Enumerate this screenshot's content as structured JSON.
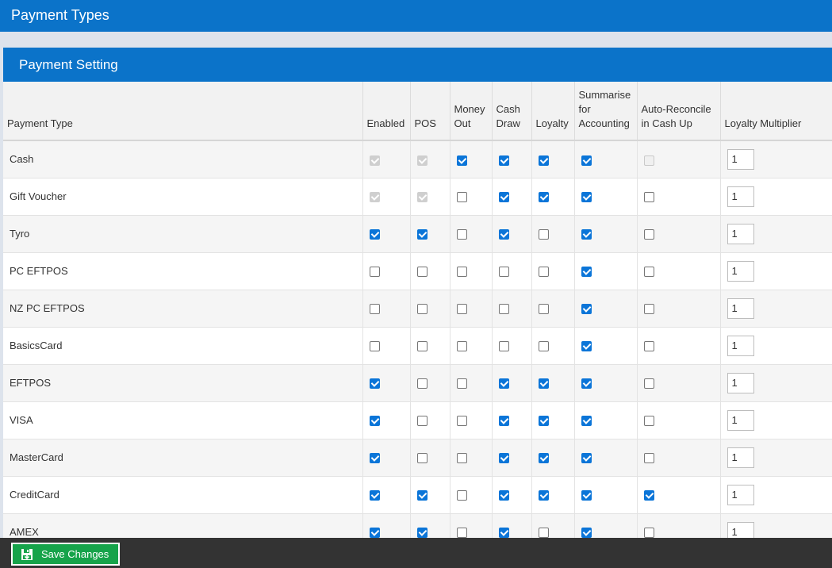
{
  "header": {
    "title": "Payment Types"
  },
  "panel": {
    "title": "Payment Setting"
  },
  "table": {
    "columns": {
      "payment_type": "Payment Type",
      "enabled": "Enabled",
      "pos": "POS",
      "money_out_1": "Money",
      "money_out_2": "Out",
      "cash_draw_1": "Cash",
      "cash_draw_2": "Draw",
      "loyalty": "Loyalty",
      "summarise_1": "Summarise",
      "summarise_2": "for",
      "summarise_3": "Accounting",
      "auto_1": "Auto-Reconcile",
      "auto_2": "in Cash Up",
      "loyalty_multiplier": "Loyalty Multiplier"
    },
    "rows": [
      {
        "name": "Cash",
        "enabled": true,
        "enabled_disabled": true,
        "pos": true,
        "pos_disabled": true,
        "money_out": true,
        "cash_draw": true,
        "loyalty": true,
        "summarise": true,
        "auto_reconcile": false,
        "auto_disabled": true,
        "multiplier": "1"
      },
      {
        "name": "Gift Voucher",
        "enabled": true,
        "enabled_disabled": true,
        "pos": true,
        "pos_disabled": true,
        "money_out": false,
        "cash_draw": true,
        "loyalty": true,
        "summarise": true,
        "auto_reconcile": false,
        "auto_disabled": false,
        "multiplier": "1"
      },
      {
        "name": "Tyro",
        "enabled": true,
        "enabled_disabled": false,
        "pos": true,
        "pos_disabled": false,
        "money_out": false,
        "cash_draw": true,
        "loyalty": false,
        "summarise": true,
        "auto_reconcile": false,
        "auto_disabled": false,
        "multiplier": "1"
      },
      {
        "name": "PC EFTPOS",
        "enabled": false,
        "enabled_disabled": false,
        "pos": false,
        "pos_disabled": false,
        "money_out": false,
        "cash_draw": false,
        "loyalty": false,
        "summarise": true,
        "auto_reconcile": false,
        "auto_disabled": false,
        "multiplier": "1"
      },
      {
        "name": "NZ PC EFTPOS",
        "enabled": false,
        "enabled_disabled": false,
        "pos": false,
        "pos_disabled": false,
        "money_out": false,
        "cash_draw": false,
        "loyalty": false,
        "summarise": true,
        "auto_reconcile": false,
        "auto_disabled": false,
        "multiplier": "1"
      },
      {
        "name": "BasicsCard",
        "enabled": false,
        "enabled_disabled": false,
        "pos": false,
        "pos_disabled": false,
        "money_out": false,
        "cash_draw": false,
        "loyalty": false,
        "summarise": true,
        "auto_reconcile": false,
        "auto_disabled": false,
        "multiplier": "1"
      },
      {
        "name": "EFTPOS",
        "enabled": true,
        "enabled_disabled": false,
        "pos": false,
        "pos_disabled": false,
        "money_out": false,
        "cash_draw": true,
        "loyalty": true,
        "summarise": true,
        "auto_reconcile": false,
        "auto_disabled": false,
        "multiplier": "1"
      },
      {
        "name": "VISA",
        "enabled": true,
        "enabled_disabled": false,
        "pos": false,
        "pos_disabled": false,
        "money_out": false,
        "cash_draw": true,
        "loyalty": true,
        "summarise": true,
        "auto_reconcile": false,
        "auto_disabled": false,
        "multiplier": "1"
      },
      {
        "name": "MasterCard",
        "enabled": true,
        "enabled_disabled": false,
        "pos": false,
        "pos_disabled": false,
        "money_out": false,
        "cash_draw": true,
        "loyalty": true,
        "summarise": true,
        "auto_reconcile": false,
        "auto_disabled": false,
        "multiplier": "1"
      },
      {
        "name": "CreditCard",
        "enabled": true,
        "enabled_disabled": false,
        "pos": true,
        "pos_disabled": false,
        "money_out": false,
        "cash_draw": true,
        "loyalty": true,
        "summarise": true,
        "auto_reconcile": true,
        "auto_disabled": false,
        "multiplier": "1"
      },
      {
        "name": "AMEX",
        "enabled": true,
        "enabled_disabled": false,
        "pos": true,
        "pos_disabled": false,
        "money_out": false,
        "cash_draw": true,
        "loyalty": false,
        "summarise": true,
        "auto_reconcile": false,
        "auto_disabled": false,
        "multiplier": "1"
      }
    ]
  },
  "footer": {
    "save_label": "Save Changes",
    "save_icon": "save-icon",
    "save_color": "#16a34a"
  },
  "colors": {
    "header_bg": "#0b73c9",
    "checkbox_checked": "#0b75d8",
    "footer_bg": "#333333"
  }
}
